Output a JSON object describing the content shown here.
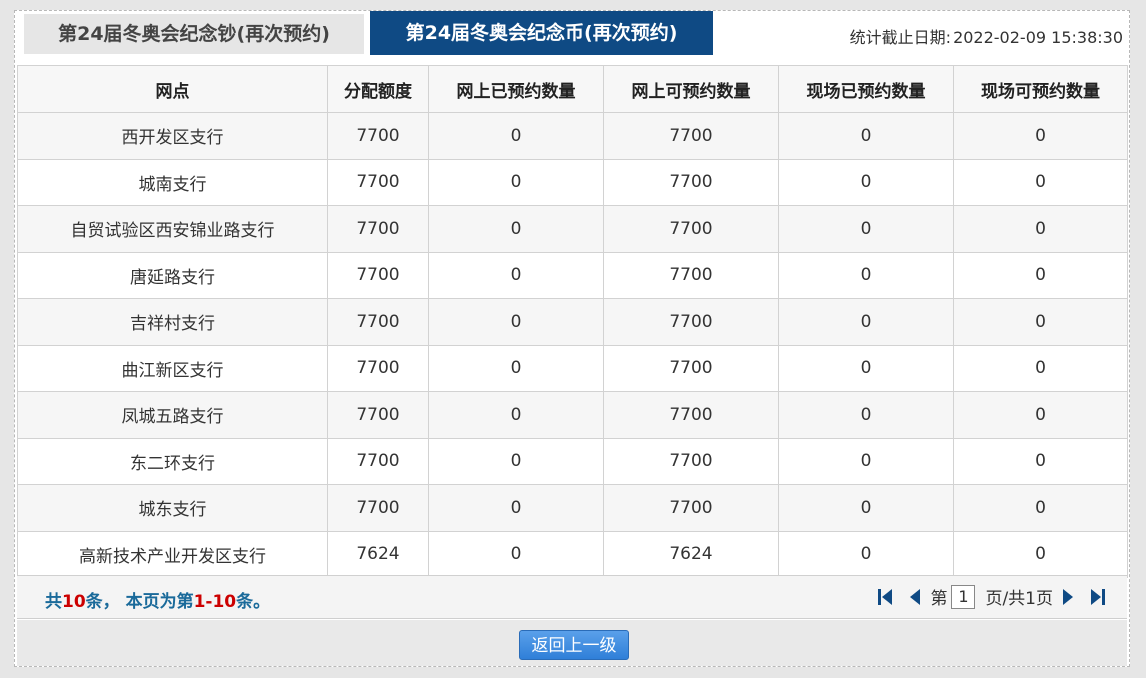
{
  "tabs": [
    {
      "label": "第24届冬奥会纪念钞(再次预约)",
      "active": false
    },
    {
      "label": "第24届冬奥会纪念币(再次预约)",
      "active": true
    }
  ],
  "stat": {
    "label": "统计截止日期:",
    "value": "2022-02-09 15:38:30"
  },
  "table": {
    "headers": [
      "网点",
      "分配额度",
      "网上已预约数量",
      "网上可预约数量",
      "现场已预约数量",
      "现场可预约数量"
    ],
    "rows": [
      [
        "西开发区支行",
        "7700",
        "0",
        "7700",
        "0",
        "0"
      ],
      [
        "城南支行",
        "7700",
        "0",
        "7700",
        "0",
        "0"
      ],
      [
        "自贸试验区西安锦业路支行",
        "7700",
        "0",
        "7700",
        "0",
        "0"
      ],
      [
        "唐延路支行",
        "7700",
        "0",
        "7700",
        "0",
        "0"
      ],
      [
        "吉祥村支行",
        "7700",
        "0",
        "7700",
        "0",
        "0"
      ],
      [
        "曲江新区支行",
        "7700",
        "0",
        "7700",
        "0",
        "0"
      ],
      [
        "凤城五路支行",
        "7700",
        "0",
        "7700",
        "0",
        "0"
      ],
      [
        "东二环支行",
        "7700",
        "0",
        "7700",
        "0",
        "0"
      ],
      [
        "城东支行",
        "7700",
        "0",
        "7700",
        "0",
        "0"
      ],
      [
        "高新技术产业开发区支行",
        "7624",
        "0",
        "7624",
        "0",
        "0"
      ]
    ]
  },
  "pager": {
    "summary_prefix": "共",
    "total": "10",
    "summary_mid": "条， 本页为第",
    "range": "1-10",
    "summary_suffix": "条。",
    "page_prefix": "第",
    "current_page": "1",
    "page_suffix": "页/共1页",
    "icons": [
      "first-page-icon",
      "prev-page-icon",
      "next-page-icon",
      "last-page-icon"
    ],
    "icon_color": "#0f4a84"
  },
  "footer": {
    "back_label": "返回上一级"
  },
  "colors": {
    "tab_active_bg": "#0f4a84",
    "tab_inactive_bg": "#e6e6e6",
    "summary_text": "#1a6a9a",
    "summary_highlight": "#cc0000",
    "button_bg": "#3d8de0"
  }
}
